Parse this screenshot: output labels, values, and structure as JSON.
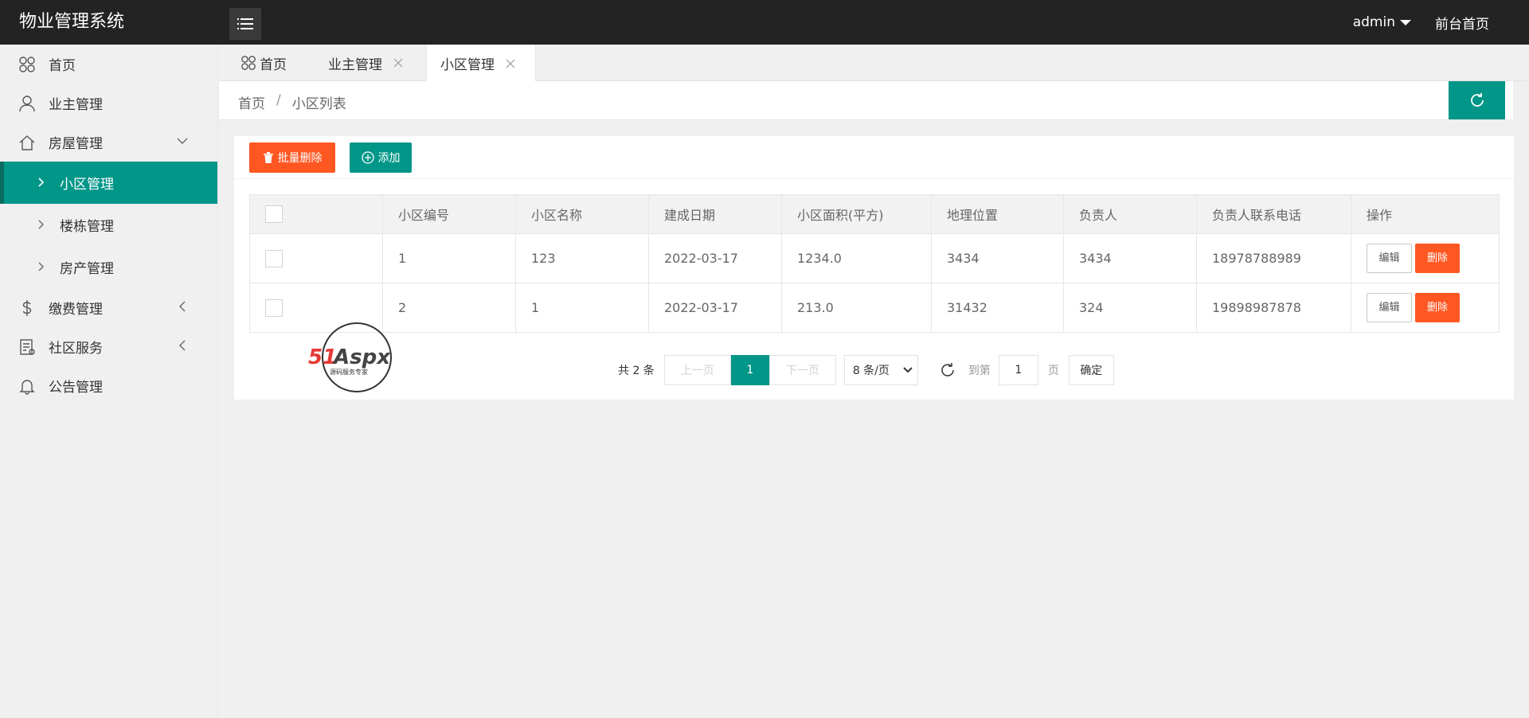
{
  "header": {
    "app_title": "物业管理系统",
    "user": "admin",
    "front_link": "前台首页"
  },
  "sidebar": {
    "items": [
      {
        "label": "首页",
        "icon": "clover-icon"
      },
      {
        "label": "业主管理",
        "icon": "user-icon"
      },
      {
        "label": "房屋管理",
        "icon": "home-icon",
        "expanded": true,
        "children": [
          {
            "label": "小区管理",
            "active": true
          },
          {
            "label": "楼栋管理"
          },
          {
            "label": "房产管理"
          }
        ]
      },
      {
        "label": "缴费管理",
        "icon": "dollar-icon"
      },
      {
        "label": "社区服务",
        "icon": "service-icon"
      },
      {
        "label": "公告管理",
        "icon": "bell-icon"
      }
    ]
  },
  "tabs": [
    {
      "label": "首页",
      "icon": "clover-icon"
    },
    {
      "label": "业主管理",
      "closable": true
    },
    {
      "label": "小区管理",
      "closable": true,
      "active": true
    }
  ],
  "breadcrumb": {
    "home": "首页",
    "separator": "/",
    "current": "小区列表"
  },
  "toolbar": {
    "batch_delete": "批量删除",
    "add": "添加"
  },
  "table": {
    "headers": [
      "小区编号",
      "小区名称",
      "建成日期",
      "小区面积(平方)",
      "地理位置",
      "负责人",
      "负责人联系电话",
      "操作"
    ],
    "rows": [
      [
        "1",
        "123",
        "2022-03-17",
        "1234.0",
        "3434",
        "3434",
        "18978788989"
      ],
      [
        "2",
        "1",
        "2022-03-17",
        "213.0",
        "31432",
        "324",
        "19898987878"
      ]
    ],
    "edit_label": "编辑",
    "delete_label": "删除"
  },
  "watermark": {
    "brand": "51Aspx",
    "tagline": "源码服务专家"
  },
  "pagination": {
    "count_text": "共 2 条",
    "prev": "上一页",
    "current_page": "1",
    "next": "下一页",
    "page_size": "8 条/页",
    "goto_label": "到第",
    "goto_value": "1",
    "page_unit": "页",
    "confirm": "确定"
  },
  "colors": {
    "primary": "#009688",
    "danger": "#ff5722",
    "header_bg": "#232323"
  }
}
